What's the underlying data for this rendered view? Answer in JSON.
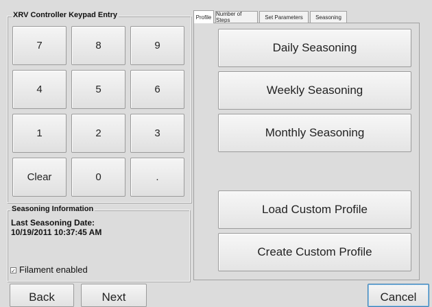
{
  "keypad": {
    "title": "XRV Controller Keypad Entry",
    "keys": [
      "7",
      "8",
      "9",
      "4",
      "5",
      "6",
      "1",
      "2",
      "3",
      "Clear",
      "0",
      "."
    ]
  },
  "seasoning_info": {
    "title": "Seasoning Information",
    "last_date_label": "Last Seasoning Date:",
    "last_date_value": "10/19/2011 10:37:45 AM",
    "filament_label": "Filament enabled",
    "filament_checked": true,
    "check_mark": "✓"
  },
  "tabs": [
    "Profile",
    "Number of Steps",
    "Set Parameters",
    "Seasoning"
  ],
  "active_tab": "Profile",
  "profile_buttons": {
    "daily": "Daily Seasoning",
    "weekly": "Weekly Seasoning",
    "monthly": "Monthly Seasoning",
    "load": "Load Custom Profile",
    "create": "Create Custom Profile"
  },
  "nav": {
    "back": "Back",
    "next": "Next",
    "cancel": "Cancel"
  },
  "colors": {
    "background": "#dcdcdc",
    "focus_border": "#3c7fb1"
  }
}
